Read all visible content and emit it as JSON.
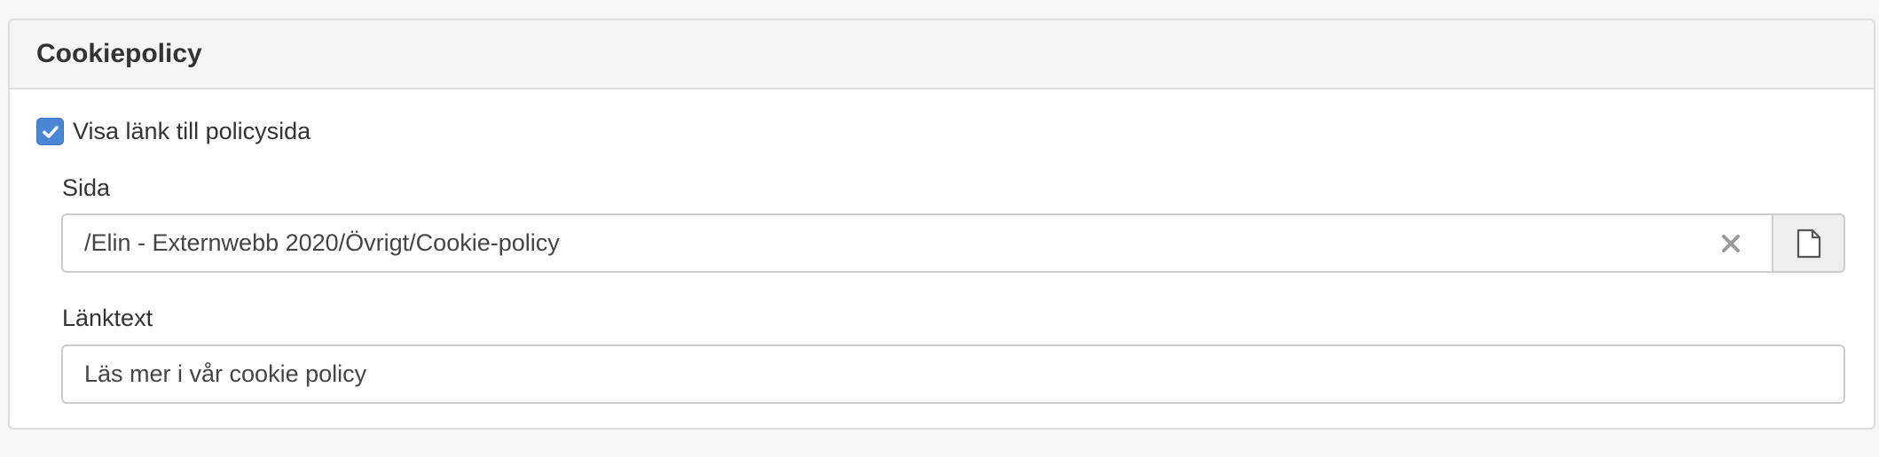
{
  "panel": {
    "title": "Cookiepolicy"
  },
  "checkbox": {
    "label": "Visa länk till policysida",
    "checked": true,
    "color": "#4a86d4"
  },
  "sida": {
    "label": "Sida",
    "value": "/Elin - Externwebb 2020/Övrigt/Cookie-policy",
    "clear_icon": "close-icon",
    "browse_icon": "file-icon"
  },
  "lanktext": {
    "label": "Länktext",
    "value": "Läs mer i vår cookie policy"
  }
}
